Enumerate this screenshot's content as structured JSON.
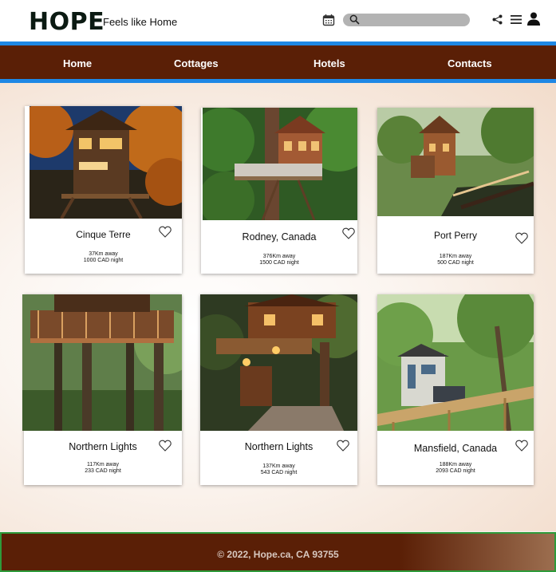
{
  "header": {
    "logo": "HOPE",
    "tagline": "Feels like Home",
    "search_placeholder": "",
    "icons": [
      "calendar-icon",
      "search-icon",
      "share-icon",
      "menu-icon",
      "user-icon"
    ]
  },
  "nav": {
    "items": [
      {
        "label": "Home"
      },
      {
        "label": "Cottages"
      },
      {
        "label": "Hotels"
      },
      {
        "label": "Contacts"
      }
    ]
  },
  "listings": [
    {
      "title": "Cinque Terre",
      "distance": "37Km away",
      "price": "1000 CAD night"
    },
    {
      "title": "Rodney, Canada",
      "distance": "376Km away",
      "price": "1500 CAD night"
    },
    {
      "title": "Port Perry",
      "distance": "187Km away",
      "price": "500 CAD night"
    },
    {
      "title": "Northern Lights",
      "distance": "117Km away",
      "price": "233 CAD night"
    },
    {
      "title": "Northern Lights",
      "distance": "137Km away",
      "price": "543 CAD night"
    },
    {
      "title": "Mansfield, Canada",
      "distance": "188Km away",
      "price": "2093 CAD night"
    }
  ],
  "footer": {
    "text": "© 2022, Hope.ca, CA 93755"
  },
  "colors": {
    "nav_bg": "#5a1f06",
    "nav_border": "#1e88e5",
    "search_bg": "#b3b3b3",
    "footer_border": "#2e9b3a"
  }
}
